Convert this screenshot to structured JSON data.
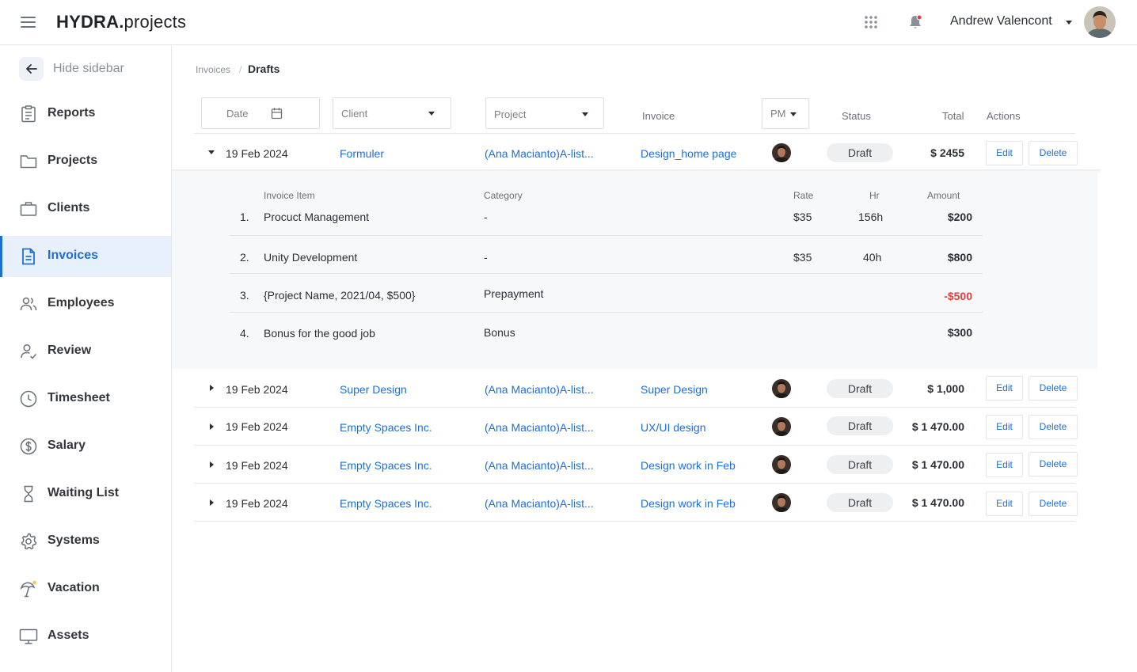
{
  "header": {
    "brand_bold": "HYDRA.",
    "brand_rest": "projects",
    "user_name": "Andrew Valencont",
    "icons": [
      "menu-icon",
      "apps-grid-icon",
      "bell-icon",
      "chevron-down-icon"
    ]
  },
  "sidebar": {
    "hide_label": "Hide sidebar",
    "items": [
      {
        "label": "Reports",
        "icon": "report-icon"
      },
      {
        "label": "Projects",
        "icon": "folder-icon"
      },
      {
        "label": "Clients",
        "icon": "briefcase-icon"
      },
      {
        "label": "Invoices",
        "icon": "invoice-icon",
        "active": true
      },
      {
        "label": "Employees",
        "icon": "users-icon"
      },
      {
        "label": "Review",
        "icon": "user-check-icon"
      },
      {
        "label": "Timesheet",
        "icon": "clock-icon"
      },
      {
        "label": "Salary",
        "icon": "dollar-icon"
      },
      {
        "label": "Waiting List",
        "icon": "hourglass-icon"
      },
      {
        "label": "Systems",
        "icon": "gear-icon"
      },
      {
        "label": "Vacation",
        "icon": "umbrella-icon"
      },
      {
        "label": "Assets",
        "icon": "monitor-icon"
      }
    ]
  },
  "breadcrumb": {
    "parent": "Invoices",
    "separator": "/",
    "current": "Drafts"
  },
  "filters": {
    "date": "Date",
    "client": "Client",
    "project": "Project",
    "pm": "PM"
  },
  "columns": {
    "invoice": "Invoice",
    "status": "Status",
    "total": "Total",
    "actions": "Actions"
  },
  "rows": [
    {
      "date": "19 Feb 2024",
      "client": "Formuler",
      "project": "(Ana Macianto)A-list...",
      "invoice": "Design_home page",
      "status": "Draft",
      "total": "$ 2455",
      "edit": "Edit",
      "delete": "Delete",
      "expanded": true
    },
    {
      "date": "19 Feb 2024",
      "client": "Super Design",
      "project": "(Ana Macianto)A-list...",
      "invoice": "Super Design",
      "status": "Draft",
      "total": "$ 1,000",
      "edit": "Edit",
      "delete": "Delete",
      "expanded": false
    },
    {
      "date": "19 Feb 2024",
      "client": "Empty Spaces Inc.",
      "project": "(Ana Macianto)A-list...",
      "invoice": "UX/UI design",
      "status": "Draft",
      "total": "$ 1 470.00",
      "edit": "Edit",
      "delete": "Delete",
      "expanded": false
    },
    {
      "date": "19 Feb 2024",
      "client": "Empty Spaces Inc.",
      "project": "(Ana Macianto)A-list...",
      "invoice": "Design work in Feb",
      "status": "Draft",
      "total": "$ 1 470.00",
      "edit": "Edit",
      "delete": "Delete",
      "expanded": false
    },
    {
      "date": "19 Feb 2024",
      "client": "Empty Spaces Inc.",
      "project": "(Ana Macianto)A-list...",
      "invoice": "Design work in Feb",
      "status": "Draft",
      "total": "$ 1 470.00",
      "edit": "Edit",
      "delete": "Delete",
      "expanded": false
    }
  ],
  "details": {
    "headers": {
      "item": "Invoice Item",
      "category": "Category",
      "rate": "Rate",
      "hr": "Hr",
      "amount": "Amount"
    },
    "items": [
      {
        "num": "1.",
        "name": "Procuct Management",
        "category": "-",
        "rate": "$35",
        "hr": "156h",
        "amount": "$200"
      },
      {
        "num": "2.",
        "name": "Unity Development",
        "category": "-",
        "rate": "$35",
        "hr": "40h",
        "amount": "$800"
      },
      {
        "num": "3.",
        "name": "{Project Name, 2021/04, $500}",
        "category": "Prepayment",
        "rate": "",
        "hr": "",
        "amount": "-$500"
      },
      {
        "num": "4.",
        "name": "Bonus for the good job",
        "category": "Bonus",
        "rate": "",
        "hr": "",
        "amount": "$300"
      }
    ]
  },
  "colors": {
    "accent": "#1f6fd1",
    "negative": "#e53e3e",
    "active_bg": "#e7f0fb"
  }
}
